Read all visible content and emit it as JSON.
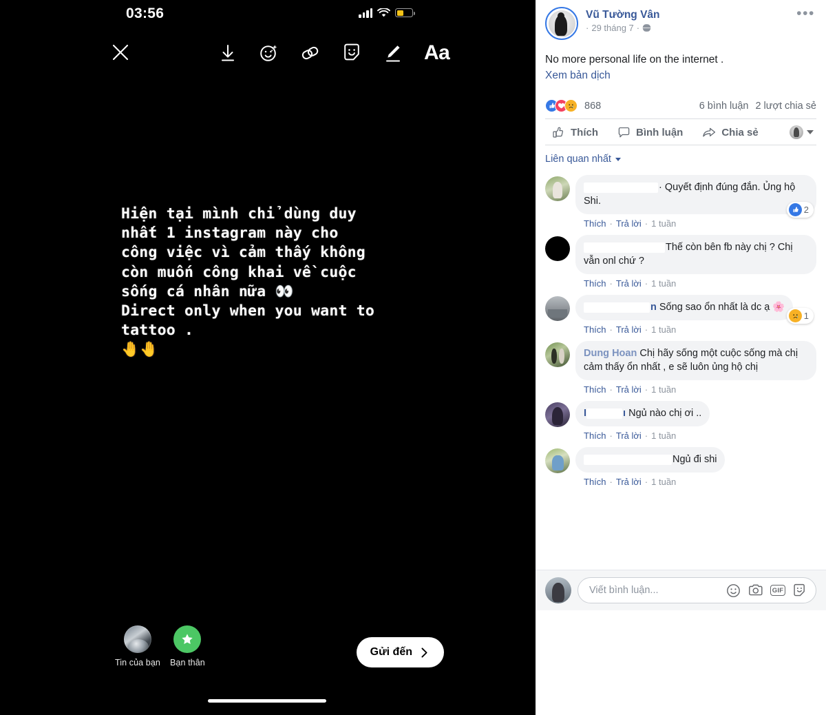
{
  "story": {
    "status_bar": {
      "time": "03:56",
      "signal": "signal-bars",
      "wifi": "wifi",
      "battery": "battery-low-power"
    },
    "toolbar": {
      "close_icon": "close-x-icon",
      "items": [
        {
          "name": "save-icon",
          "label": "Lưu"
        },
        {
          "name": "effects-icon",
          "label": "Hiệu ứng"
        },
        {
          "name": "link-icon",
          "label": "Liên kết"
        },
        {
          "name": "sticker-icon",
          "label": "Nhãn dán"
        },
        {
          "name": "draw-icon",
          "label": "Vẽ"
        },
        {
          "name": "text-icon",
          "label": "Aa"
        }
      ]
    },
    "text": "Hiện tại mình chỉ dùng duy\nnhất 1 instagram này cho\ncông việc vì cảm thấy không\ncòn muốn công khai về cuộc\nsống cá nhân nữa 👀\nDirect only when you want to\ntattoo .\n🤚🤚",
    "audience": [
      {
        "label": "Tin của bạn",
        "icon": "user-avatar"
      },
      {
        "label": "Bạn thân",
        "icon": "green-star-icon"
      }
    ],
    "send_button": {
      "label": "Gửi đến",
      "icon": "chevron-right-icon"
    }
  },
  "facebook": {
    "post": {
      "author": "Vũ Tường Vân",
      "date": "29 tháng 7",
      "date_prefix": "·",
      "privacy_icon": "globe-icon",
      "menu_icon": "ellipsis-icon",
      "text": "No more personal life on the internet .",
      "translate_link": "Xem bản dịch"
    },
    "reactions": {
      "icons": [
        "like-reaction",
        "love-reaction",
        "sad-reaction"
      ],
      "emoji": [
        "👍",
        "❤",
        "😢"
      ],
      "count": "868",
      "comments_count": "6 bình luận",
      "shares_count": "2 lượt chia sẻ"
    },
    "actions": [
      {
        "label": "Thích",
        "icon": "thumbs-up-icon"
      },
      {
        "label": "Bình luận",
        "icon": "comment-bubble-icon"
      },
      {
        "label": "Chia sẻ",
        "icon": "share-arrow-icon"
      }
    ],
    "audience_selector": {
      "icon": "audience-avatar",
      "caret": "chevron-down-icon"
    },
    "sort": {
      "label": "Liên quan nhất",
      "caret": "chevron-down-icon"
    },
    "comment_actions": {
      "like": "Thích",
      "reply": "Trả lời",
      "sep": "·"
    },
    "comments": [
      {
        "avatar": "av-g1",
        "name_redacted": true,
        "name_width": 108,
        "text": "· Quyết định đúng đắn. Ủng hộ Shi.",
        "time": "1 tuần",
        "badge": {
          "icon": "like-reaction",
          "emoji": "👍",
          "count": "2",
          "type": "like"
        }
      },
      {
        "avatar": "av-g2",
        "name_redacted": true,
        "name_width": 118,
        "text": "Thế còn bên fb này chị ? Chị vẫn onl chứ ?",
        "time": "1 tuần",
        "badge": null
      },
      {
        "avatar": "av-g3",
        "name_redacted": true,
        "name_width": 96,
        "name_tail": "n",
        "text": "Sống sao ổn nhất là dc ạ 🌸",
        "time": "1 tuần",
        "badge": {
          "icon": "sad-reaction",
          "emoji": "😢",
          "count": "1",
          "type": "sad"
        }
      },
      {
        "avatar": "av-g4",
        "name_redacted": false,
        "name": "Dung Hoan",
        "name_faded": true,
        "text": "Chị hãy sống một cuộc sống mà chị cảm thấy ổn nhất , e sẽ luôn ủng hộ chị",
        "time": "1 tuần",
        "badge": null
      },
      {
        "avatar": "av-g5",
        "name_redacted": true,
        "name_width": 52,
        "name_lead": "I",
        "name_tail": "ı",
        "text": "Ngủ nào chị ơi ..",
        "time": "1 tuần",
        "badge": null
      },
      {
        "avatar": "av-g6",
        "name_redacted": true,
        "name_width": 128,
        "text": "Ngủ đi shi",
        "time": "1 tuần",
        "badge": null
      }
    ],
    "composer": {
      "placeholder": "Viết bình luận...",
      "avatar": "user-avatar",
      "icons": [
        {
          "name": "emoji-icon",
          "label": "Emoji"
        },
        {
          "name": "camera-icon",
          "label": "Camera"
        },
        {
          "name": "gif-icon",
          "label": "GIF"
        },
        {
          "name": "sticker-icon",
          "label": "Nhãn dán"
        }
      ]
    }
  },
  "colors": {
    "fb_blue": "#385898",
    "like_blue": "#3578E5",
    "love_red": "#F3425F",
    "sad_yellow": "#F7B125",
    "green_star": "#4cc764",
    "text_dark": "#1c1e21",
    "text_muted": "#606770"
  }
}
